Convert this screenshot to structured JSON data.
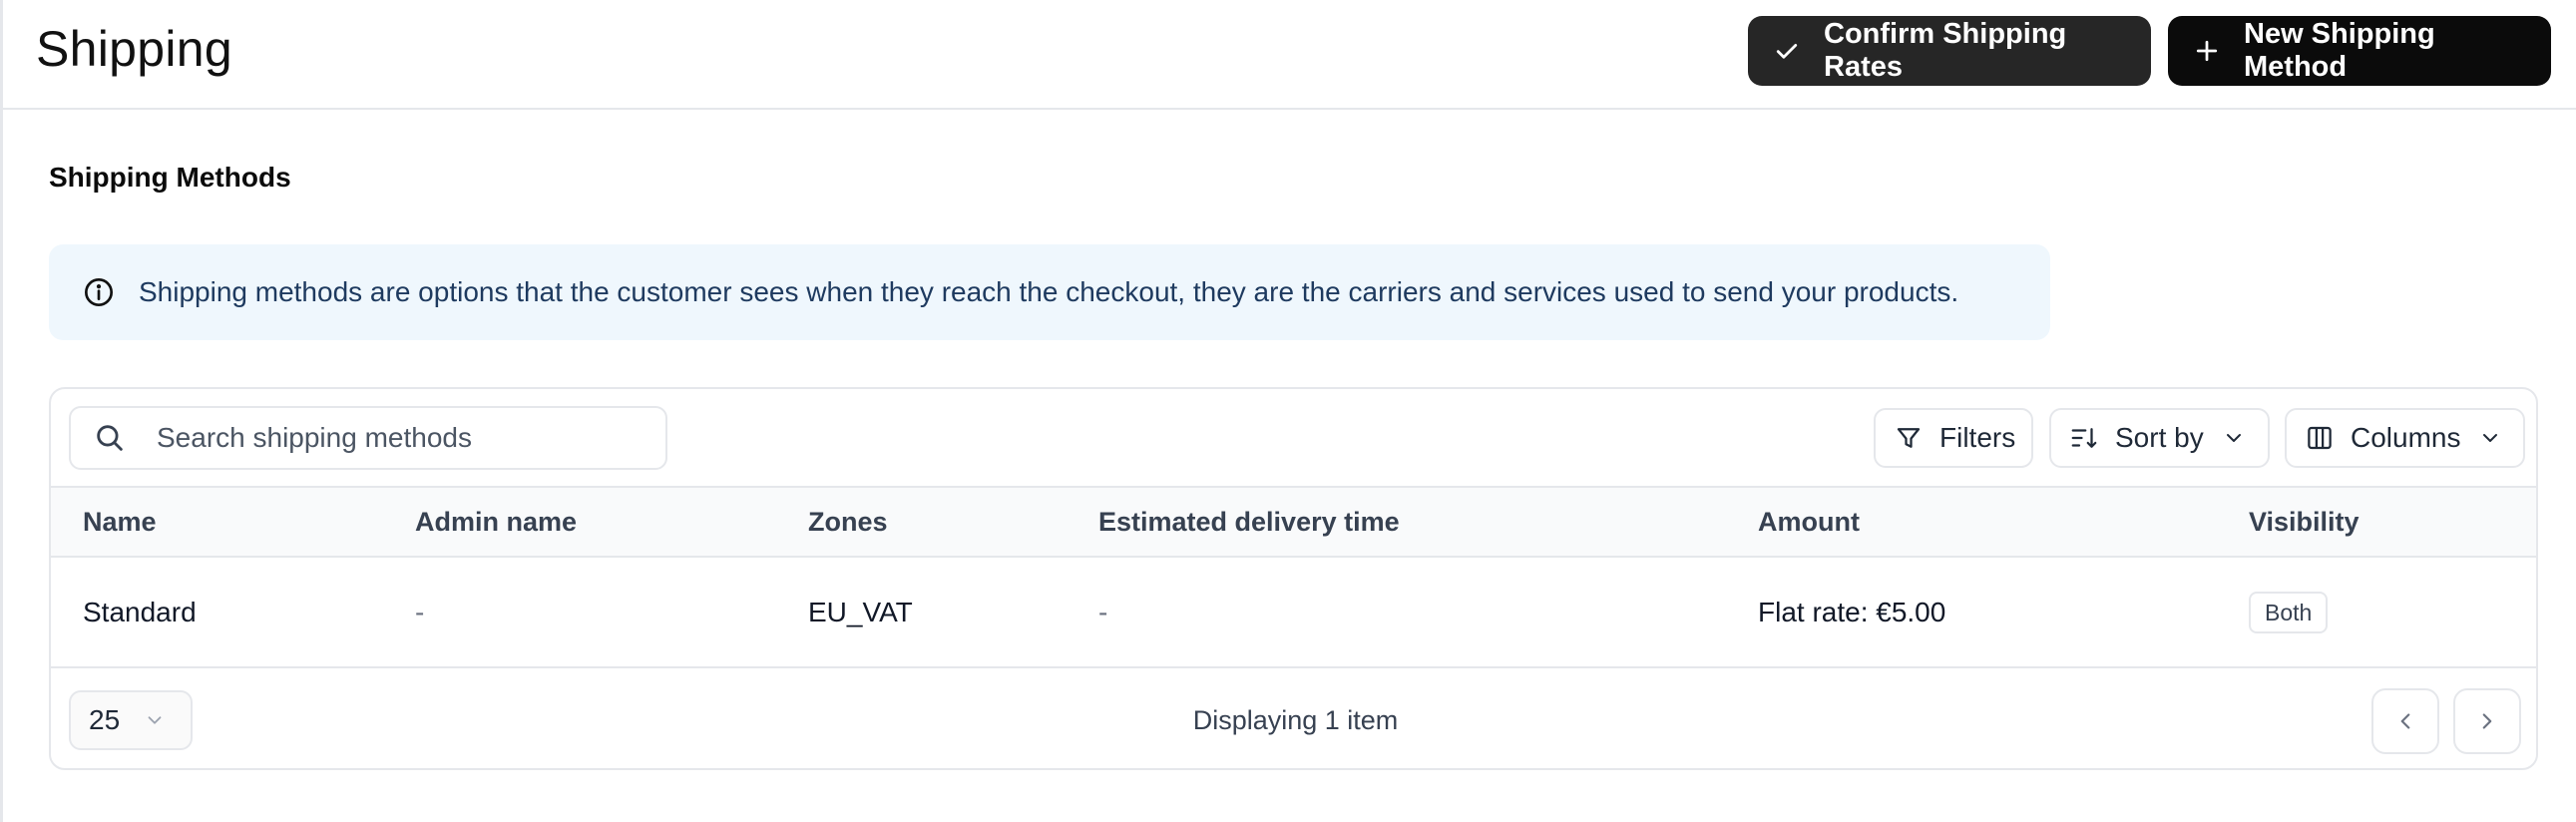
{
  "header": {
    "title": "Shipping",
    "confirm_label": "Confirm Shipping Rates",
    "new_label": "New Shipping Method"
  },
  "section": {
    "title": "Shipping Methods",
    "info_text": "Shipping methods are options that the customer sees when they reach the checkout, they are the carriers and services used to send your products."
  },
  "toolbar": {
    "search_placeholder": "Search shipping methods",
    "filters_label": "Filters",
    "sort_label": "Sort by",
    "columns_label": "Columns"
  },
  "table": {
    "columns": [
      "Name",
      "Admin name",
      "Zones",
      "Estimated delivery time",
      "Amount",
      "Visibility"
    ],
    "rows": [
      {
        "name": "Standard",
        "admin_name": "-",
        "zones": "EU_VAT",
        "estimated_delivery_time": "-",
        "amount": "Flat rate: €5.00",
        "visibility": "Both"
      }
    ]
  },
  "pagination": {
    "per_page": "25",
    "status": "Displaying 1 item"
  },
  "icons": {
    "confirm": "check-icon",
    "new": "plus-icon",
    "info": "info-circle-icon",
    "search": "search-icon",
    "filters": "funnel-icon",
    "sort": "sort-icon",
    "columns": "columns-icon",
    "dropdown": "chevron-down-icon",
    "prev": "chevron-left-icon",
    "next": "chevron-right-icon"
  },
  "colors": {
    "primary_button": "#0b0b0b",
    "secondary_dark_button": "#262626",
    "info_banner_bg": "#eff7fd",
    "border": "#e5e7eb",
    "table_header_bg": "#f9fafb"
  }
}
